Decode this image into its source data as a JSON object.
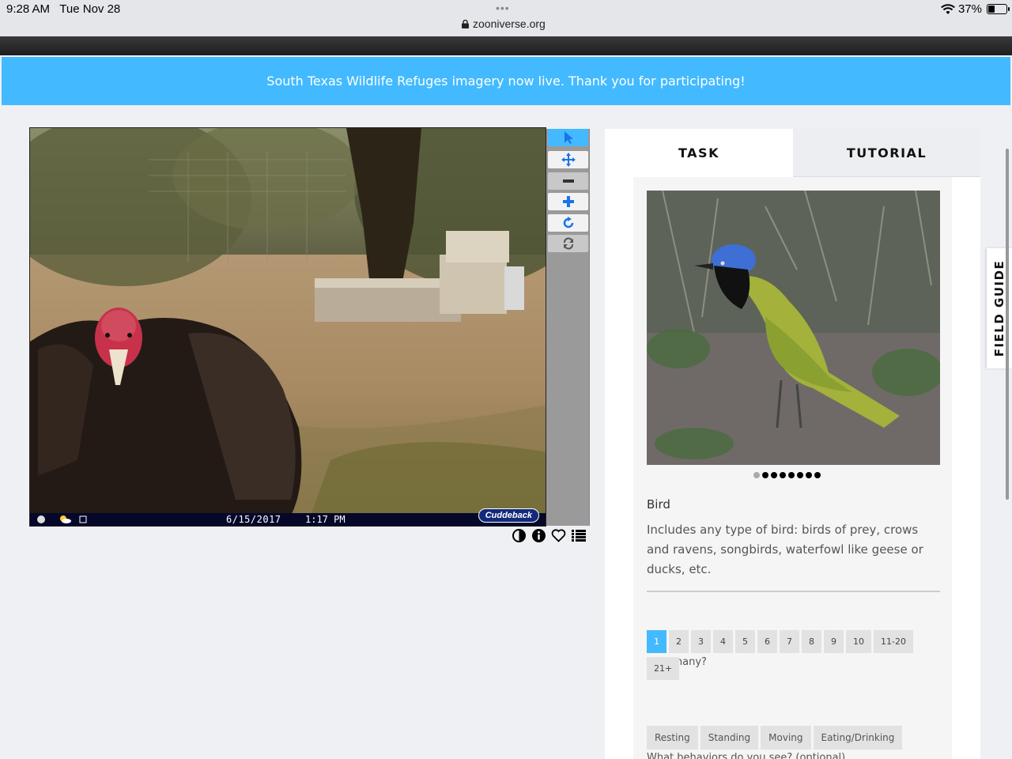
{
  "status_bar": {
    "time": "9:28 AM",
    "date": "Tue Nov 28",
    "url": "zooniverse.org",
    "battery": "37%",
    "battery_level": 0.37
  },
  "announcement": "South Texas Wildlife Refuges imagery now live. Thank you for participating!",
  "subject": {
    "cam_date": "6/15/2017",
    "cam_time": "1:17 PM",
    "cam_brand": "Cuddeback"
  },
  "toolbar": {
    "tools": [
      "pointer-icon",
      "move-icon",
      "zoom-out-icon",
      "zoom-in-icon",
      "rotate-icon",
      "reset-icon"
    ]
  },
  "meta_icons": [
    "contrast-icon",
    "info-icon",
    "favorite-heart-icon",
    "collection-list-icon"
  ],
  "tabs": {
    "task": "TASK",
    "tutorial": "TUTORIAL"
  },
  "species": {
    "name": "Bird",
    "description": "Includes any type of bird: birds of prey, crows and ravens, songbirds, waterfowl like geese or ducks, etc.",
    "image_count": 8,
    "current_image": 1
  },
  "how_many": {
    "question": "How many?",
    "options": [
      "1",
      "2",
      "3",
      "4",
      "5",
      "6",
      "7",
      "8",
      "9",
      "10",
      "11-20",
      "21+"
    ],
    "selected": "1"
  },
  "behaviors": {
    "question": "What behaviors do you see? (optional)",
    "options": [
      "Resting",
      "Standing",
      "Moving",
      "Eating/Drinking"
    ]
  },
  "field_guide": "FIELD GUIDE",
  "colors": {
    "accent": "#43baff",
    "background": "#eef0f4"
  }
}
